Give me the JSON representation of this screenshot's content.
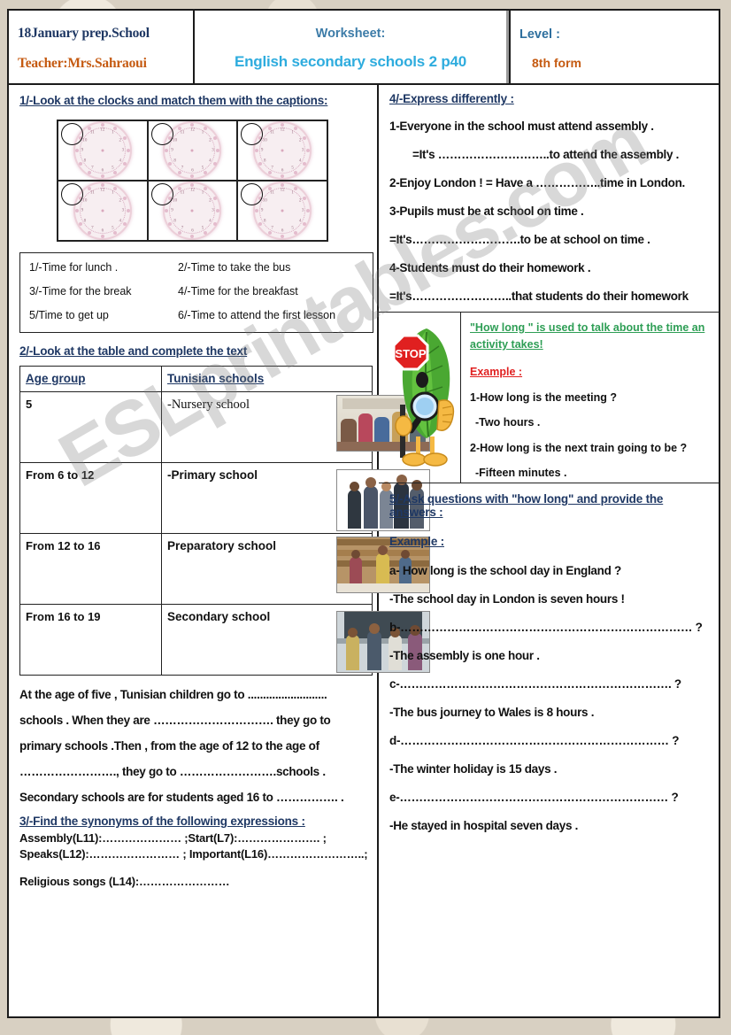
{
  "header": {
    "school": "18January prep.School",
    "teacher": "Teacher:Mrs.Sahraoui",
    "worksheet_label": "Worksheet:",
    "worksheet_title": "English secondary schools 2 p40",
    "level_label": "Level :",
    "level_value": "8th form"
  },
  "ex1": {
    "title": "1/-Look at the clocks and match them with the captions:",
    "clock_count": 6,
    "clock_numerals": [
      "12",
      "1",
      "2",
      "3",
      "4",
      "5",
      "6",
      "7",
      "8",
      "9",
      "10",
      "11"
    ],
    "captions": [
      {
        "a": "1/-Time for lunch .",
        "b": "2/-Time to take the bus"
      },
      {
        "a": "3/-Time for the break",
        "b": "4/-Time for the breakfast"
      },
      {
        "a": "5/Time to get up",
        "b": "6/-Time to attend the first lesson"
      }
    ]
  },
  "ex2": {
    "title": "2/-Look at the table and complete the text",
    "table": {
      "headers": [
        "Age group",
        "Tunisian schools"
      ],
      "rows": [
        {
          "age": "5",
          "school": "-Nursery school",
          "photo": "nursery-classroom-photo"
        },
        {
          "age": "From 6 to 12",
          "school": "-Primary school",
          "photo": "primary-pupils-photo"
        },
        {
          "age": "From 12 to 16",
          "school": "Preparatory  school",
          "photo": "library-students-photo"
        },
        {
          "age": "From 16 to 19",
          "school": "Secondary school",
          "photo": "secondary-students-photo"
        }
      ]
    },
    "paragraph": [
      "At the age of five , Tunisian children go to ..........................",
      " schools . When they are …………………………. they go to",
      " primary schools .Then , from the age of 12 to the age of",
      "……………………., they go to …………………….schools .",
      "Secondary schools  are for students  aged 16 to ……………. ."
    ]
  },
  "ex3": {
    "title": "3/-Find the synonyms  of  the following  expressions :",
    "lines": [
      "Assembly(L11):………………… ;Start(L7):…………………. ;",
      "Speaks(L12):…………………… ; Important(L16)……………………..;",
      "Religious songs (L14):……………………"
    ]
  },
  "ex4": {
    "title": "4/-Express differently :",
    "items": [
      "1-Everyone in the school must attend assembly .",
      "=It's ………………………..to attend the assembly .",
      "2-Enjoy London ! = Have a ……………..time in London.",
      "3-Pupils must be at school on time .",
      "=It's……………………….to be at school on time .",
      "4-Students must do their homework .",
      "=It's……………………..that students do their homework"
    ]
  },
  "howlong": {
    "mascot": "stop-sign-leaf-character",
    "rule": "\"How long \" is used to talk about the time an activity takes!",
    "example_label": "Example :",
    "q1": "1-How long is the meeting ?",
    "a1": "-Two hours .",
    "q2": "2-How long is the next train going to be ?",
    "a2": "-Fifteen minutes ."
  },
  "ex5": {
    "title": "5/-Ask questions with \"how long\" and provide the answers :",
    "example_label": "Example :",
    "lines": [
      "a- How long is the school day in England  ?",
      "-The school day in London is  seven hours !",
      "b-………………………………………………………………… ?",
      "-The  assembly is one hour .",
      "c-……………………………………………………………. ?",
      "-The bus journey to Wales is 8 hours .",
      "d-…………………………………………………………… ?",
      "-The winter holiday is 15 days .",
      "e-…………………………………………………………… ?",
      "-He stayed in hospital seven days ."
    ]
  },
  "watermark": {
    "text": "ESLprintables.com"
  },
  "colors": {
    "title_blue": "#1f3864",
    "accent_cyan": "#2eacde",
    "accent_orange": "#c55a11",
    "rule_green": "#2e9e55",
    "example_red": "#e02020"
  }
}
